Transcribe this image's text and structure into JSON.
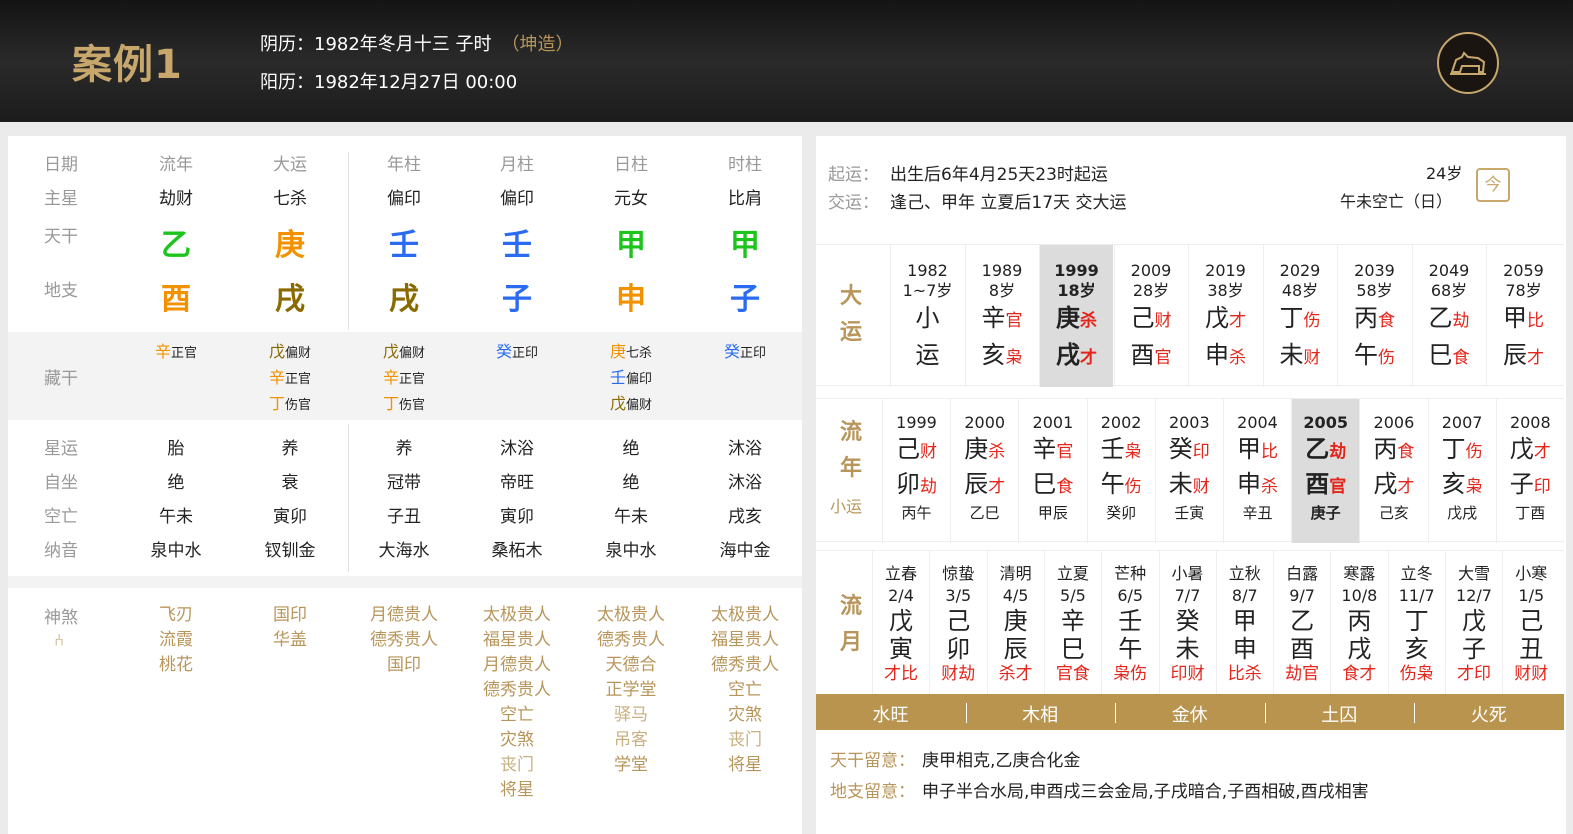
{
  "header": {
    "title": "案例1",
    "lunar": "阴历：1982年冬月十三 子时",
    "gender": "（坤造）",
    "solar": "阳历：1982年12月27日 00:00"
  },
  "left": {
    "cols": [
      "流年",
      "大运",
      "年柱",
      "月柱",
      "日柱",
      "时柱"
    ],
    "labels": {
      "riqi": "日期",
      "zhuxing": "主星",
      "tiangan": "天干",
      "dizhi": "地支",
      "canggan": "藏干",
      "xingyun": "星运",
      "zizuo": "自坐",
      "kongwang": "空亡",
      "nayin": "纳音",
      "shensha": "神煞"
    },
    "zhuxing": [
      "劫财",
      "七杀",
      "偏印",
      "偏印",
      "元女",
      "比肩"
    ],
    "tiangan": [
      "乙",
      "庚",
      "壬",
      "壬",
      "甲",
      "甲"
    ],
    "dizhi": [
      "酉",
      "戌",
      "戌",
      "子",
      "申",
      "子"
    ],
    "canggan": [
      [
        [
          "辛",
          "正官"
        ]
      ],
      [
        [
          "戊",
          "偏财"
        ],
        [
          "辛",
          "正官"
        ],
        [
          "丁",
          "伤官"
        ]
      ],
      [
        [
          "戊",
          "偏财"
        ],
        [
          "辛",
          "正官"
        ],
        [
          "丁",
          "伤官"
        ]
      ],
      [
        [
          "癸",
          "正印"
        ]
      ],
      [
        [
          "庚",
          "七杀"
        ],
        [
          "壬",
          "偏印"
        ],
        [
          "戊",
          "偏财"
        ]
      ],
      [
        [
          "癸",
          "正印"
        ]
      ]
    ],
    "xingyun": [
      "胎",
      "养",
      "养",
      "沐浴",
      "绝",
      "沐浴"
    ],
    "zizuo": [
      "绝",
      "衰",
      "冠带",
      "帝旺",
      "绝",
      "沐浴"
    ],
    "kongwang": [
      "午未",
      "寅卯",
      "子丑",
      "寅卯",
      "午未",
      "戌亥"
    ],
    "nayin": [
      "泉中水",
      "钗钏金",
      "大海水",
      "桑柘木",
      "泉中水",
      "海中金"
    ],
    "shensha_icon": "⑃",
    "shensha": [
      [
        "飞刃",
        "流霞",
        "桃花"
      ],
      [
        "国印",
        "华盖"
      ],
      [
        "月德贵人",
        "德秀贵人",
        "国印"
      ],
      [
        "太极贵人",
        "福星贵人",
        "月德贵人",
        "德秀贵人",
        "空亡",
        "灾煞",
        "丧门",
        "将星"
      ],
      [
        "太极贵人",
        "德秀贵人",
        "天德合",
        "正学堂",
        "驿马",
        "吊客",
        "学堂"
      ],
      [
        "太极贵人",
        "福星贵人",
        "德秀贵人",
        "空亡",
        "灾煞",
        "丧门",
        "将星"
      ]
    ]
  },
  "right": {
    "qiyun_label": "起运：",
    "qiyun": "出生后6年4月25天23时起运",
    "jiaoyun_label": "交运：",
    "jiaoyun": "逢己、甲年 立夏后17天 交大运",
    "age": "24岁",
    "kongwang": "午未空亡（日）",
    "today_icon": "今",
    "dayun_title": [
      "大",
      "运"
    ],
    "dayun": [
      {
        "y": "1982",
        "a": "1~7岁",
        "g": "小",
        "gt": "",
        "z": "运",
        "zt": ""
      },
      {
        "y": "1989",
        "a": "8岁",
        "g": "辛",
        "gt": "官",
        "z": "亥",
        "zt": "枭"
      },
      {
        "y": "1999",
        "a": "18岁",
        "g": "庚",
        "gt": "杀",
        "z": "戌",
        "zt": "才"
      },
      {
        "y": "2009",
        "a": "28岁",
        "g": "己",
        "gt": "财",
        "z": "酉",
        "zt": "官"
      },
      {
        "y": "2019",
        "a": "38岁",
        "g": "戊",
        "gt": "才",
        "z": "申",
        "zt": "杀"
      },
      {
        "y": "2029",
        "a": "48岁",
        "g": "丁",
        "gt": "伤",
        "z": "未",
        "zt": "财"
      },
      {
        "y": "2039",
        "a": "58岁",
        "g": "丙",
        "gt": "食",
        "z": "午",
        "zt": "伤"
      },
      {
        "y": "2049",
        "a": "68岁",
        "g": "乙",
        "gt": "劫",
        "z": "巳",
        "zt": "食"
      },
      {
        "y": "2059",
        "a": "78岁",
        "g": "甲",
        "gt": "比",
        "z": "辰",
        "zt": "才"
      }
    ],
    "liunian_title": [
      "流",
      "年"
    ],
    "xiaoyun_label": "小运",
    "liunian": [
      {
        "y": "1999",
        "g": "己",
        "gt": "财",
        "z": "卯",
        "zt": "劫",
        "x": "丙午"
      },
      {
        "y": "2000",
        "g": "庚",
        "gt": "杀",
        "z": "辰",
        "zt": "才",
        "x": "乙巳"
      },
      {
        "y": "2001",
        "g": "辛",
        "gt": "官",
        "z": "巳",
        "zt": "食",
        "x": "甲辰"
      },
      {
        "y": "2002",
        "g": "壬",
        "gt": "枭",
        "z": "午",
        "zt": "伤",
        "x": "癸卯"
      },
      {
        "y": "2003",
        "g": "癸",
        "gt": "印",
        "z": "未",
        "zt": "财",
        "x": "壬寅"
      },
      {
        "y": "2004",
        "g": "甲",
        "gt": "比",
        "z": "申",
        "zt": "杀",
        "x": "辛丑"
      },
      {
        "y": "2005",
        "g": "乙",
        "gt": "劫",
        "z": "酉",
        "zt": "官",
        "x": "庚子"
      },
      {
        "y": "2006",
        "g": "丙",
        "gt": "食",
        "z": "戌",
        "zt": "才",
        "x": "己亥"
      },
      {
        "y": "2007",
        "g": "丁",
        "gt": "伤",
        "z": "亥",
        "zt": "枭",
        "x": "戊戌"
      },
      {
        "y": "2008",
        "g": "戊",
        "gt": "才",
        "z": "子",
        "zt": "印",
        "x": "丁酉"
      }
    ],
    "liuyue_title": [
      "流",
      "月"
    ],
    "liuyue": [
      {
        "j": "立春",
        "d": "2/4",
        "g": "戊",
        "z": "寅",
        "t": "才比"
      },
      {
        "j": "惊蛰",
        "d": "3/5",
        "g": "己",
        "z": "卯",
        "t": "财劫"
      },
      {
        "j": "清明",
        "d": "4/5",
        "g": "庚",
        "z": "辰",
        "t": "杀才"
      },
      {
        "j": "立夏",
        "d": "5/5",
        "g": "辛",
        "z": "巳",
        "t": "官食"
      },
      {
        "j": "芒种",
        "d": "6/5",
        "g": "壬",
        "z": "午",
        "t": "枭伤"
      },
      {
        "j": "小暑",
        "d": "7/7",
        "g": "癸",
        "z": "未",
        "t": "印财"
      },
      {
        "j": "立秋",
        "d": "8/7",
        "g": "甲",
        "z": "申",
        "t": "比杀"
      },
      {
        "j": "白露",
        "d": "9/7",
        "g": "乙",
        "z": "酉",
        "t": "劫官"
      },
      {
        "j": "寒露",
        "d": "10/8",
        "g": "丙",
        "z": "戌",
        "t": "食才"
      },
      {
        "j": "立冬",
        "d": "11/7",
        "g": "丁",
        "z": "亥",
        "t": "伤枭"
      },
      {
        "j": "大雪",
        "d": "12/7",
        "g": "戊",
        "z": "子",
        "t": "才印"
      },
      {
        "j": "小寒",
        "d": "1/5",
        "g": "己",
        "z": "丑",
        "t": "财财"
      }
    ],
    "wuxing": [
      "水旺",
      "木相",
      "金休",
      "土囚",
      "火死"
    ],
    "tg_label": "天干留意：",
    "tg_text": "庚甲相克,乙庚合化金",
    "dz_label": "地支留意：",
    "dz_text": "申子半合水局,申酉戌三会金局,子戌暗合,子酉相破,酉戌相害"
  },
  "colors": {
    "gold": "#b8955a",
    "wood": "#1cc41c",
    "fire": "#f29200",
    "water": "#2a6bf2",
    "earth": "#8a6a00",
    "red": "#e3261b"
  }
}
